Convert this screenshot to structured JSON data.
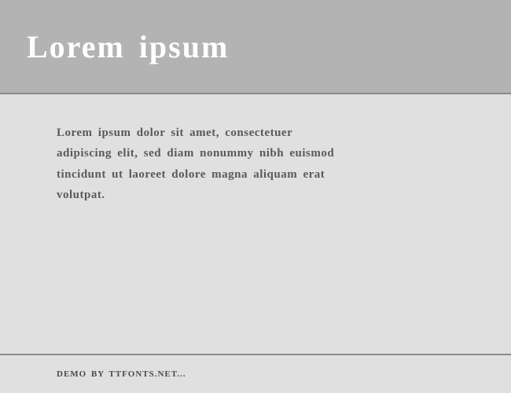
{
  "header": {
    "title": "Lorem ipsum"
  },
  "content": {
    "paragraph": "Lorem ipsum dolor sit amet, consectetuer adipiscing elit, sed diam nonummy nibh euismod tincidunt ut laoreet dolore magna aliquam erat volutpat."
  },
  "footer": {
    "text": "DEMO BY TTFONTS.NET..."
  }
}
